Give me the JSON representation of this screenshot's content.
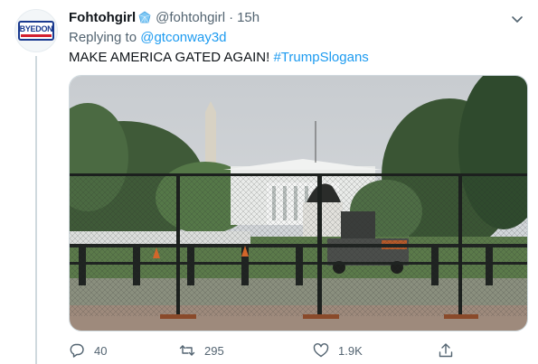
{
  "tweet": {
    "display_name": "Fohtohgirl",
    "handle": "@fohtohgirl",
    "separator": "·",
    "time": "15h",
    "reply_prefix": "Replying to",
    "reply_to": "@gtconway3d",
    "text_main": "MAKE AMERICA GATED AGAIN!",
    "hashtag": "#TrumpSlogans",
    "avatar_logo_text": "BYEDON"
  },
  "actions": {
    "reply_count": "40",
    "retweet_count": "295",
    "like_count": "1.9K"
  },
  "icons": {
    "verified": "verified-badge-icon",
    "more": "chevron-down-icon",
    "reply": "reply-icon",
    "retweet": "retweet-icon",
    "like": "heart-icon",
    "share": "share-icon"
  },
  "colors": {
    "accent": "#1d9bf0",
    "text": "#0f1419",
    "muted": "#536471",
    "border": "#cfd9de"
  }
}
